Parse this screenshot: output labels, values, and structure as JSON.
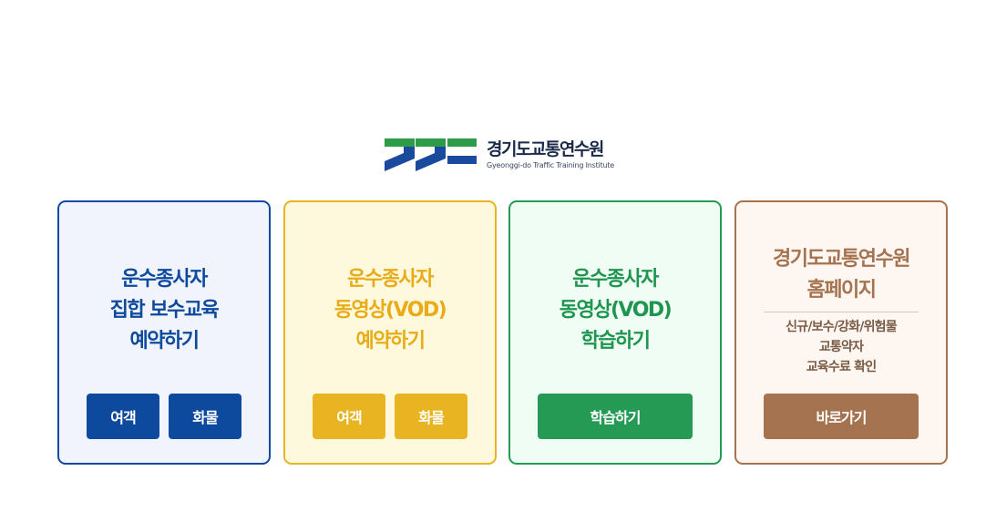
{
  "logo": {
    "name": "경기도교통연수원",
    "subtitle": "Gyeonggi-do Traffic Training Institute"
  },
  "colors": {
    "blue": "#0d4a9e",
    "yellow": "#e8b422",
    "green": "#249a54",
    "brown": "#a5734f"
  },
  "cards": [
    {
      "title": "운수종사자\n집합 보수교육\n예약하기",
      "buttons": [
        "여객",
        "화물"
      ]
    },
    {
      "title": "운수종사자\n동영상(VOD)\n예약하기",
      "buttons": [
        "여객",
        "화물"
      ]
    },
    {
      "title": "운수종사자\n동영상(VOD)\n학습하기",
      "buttons": [
        "학습하기"
      ]
    },
    {
      "title": "경기도교통연수원\n홈페이지",
      "description": "신규/보수/강화/위험물\n교통약자\n교육수료 확인",
      "buttons": [
        "바로가기"
      ]
    }
  ]
}
